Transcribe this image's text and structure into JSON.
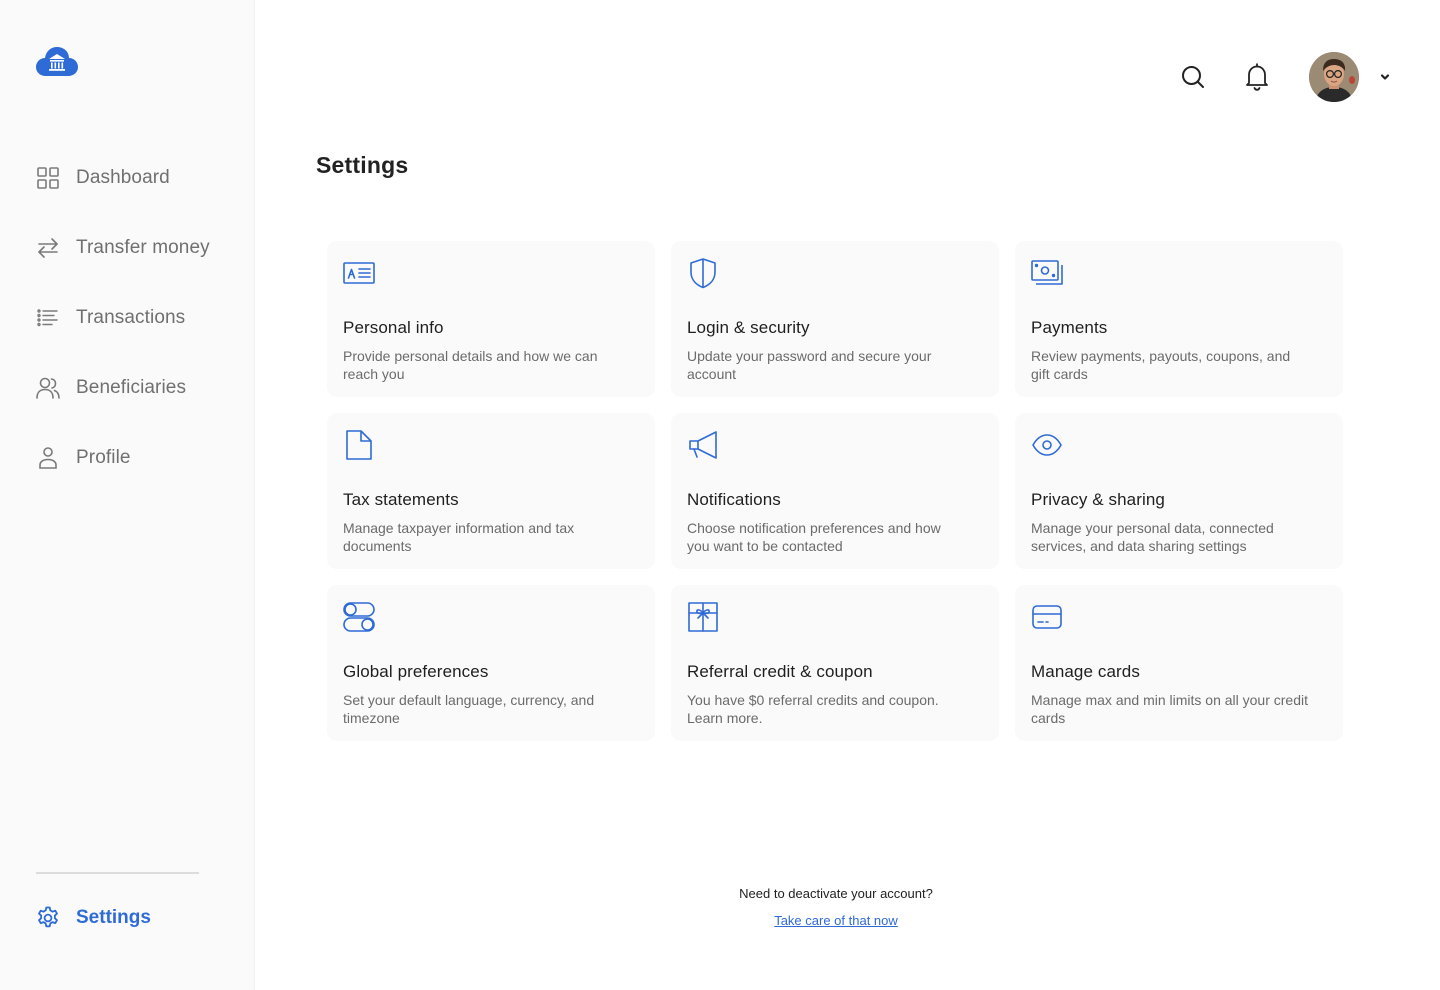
{
  "brand": {
    "logo_icon": "cloud-bank-icon",
    "accent_color": "#2f6bd6"
  },
  "sidebar": {
    "items": [
      {
        "label": "Dashboard",
        "icon": "grid-icon"
      },
      {
        "label": "Transfer money",
        "icon": "transfer-arrows-icon"
      },
      {
        "label": "Transactions",
        "icon": "list-icon"
      },
      {
        "label": "Beneficiaries",
        "icon": "users-icon"
      },
      {
        "label": "Profile",
        "icon": "person-icon"
      }
    ],
    "settings": {
      "label": "Settings",
      "icon": "gear-icon",
      "active": true
    }
  },
  "topbar": {
    "search_icon": "search-icon",
    "notifications_icon": "bell-icon",
    "avatar": "user-avatar",
    "menu_icon": "chevron-down-icon"
  },
  "main": {
    "title": "Settings",
    "cards": [
      {
        "title": "Personal info",
        "description": "Provide personal details and how we can reach you",
        "icon": "id-card-icon"
      },
      {
        "title": "Login & security",
        "description": "Update your password and secure your account",
        "icon": "shield-icon"
      },
      {
        "title": "Payments",
        "description": "Review payments, payouts, coupons, and gift cards",
        "icon": "banknote-icon"
      },
      {
        "title": "Tax statements",
        "description": "Manage taxpayer information and tax documents",
        "icon": "document-icon"
      },
      {
        "title": "Notifications",
        "description": "Choose notification preferences and how you want to be contacted",
        "icon": "megaphone-icon"
      },
      {
        "title": "Privacy & sharing",
        "description": "Manage your personal data, connected services, and data sharing settings",
        "icon": "eye-icon"
      },
      {
        "title": "Global preferences",
        "description": "Set your default language, currency, and timezone",
        "icon": "toggles-icon"
      },
      {
        "title": "Referral credit & coupon",
        "description": "You have $0 referral credits and coupon. Learn more.",
        "icon": "gift-icon"
      },
      {
        "title": "Manage cards",
        "description": "Manage max and min limits on all your credit cards",
        "icon": "credit-card-icon"
      }
    ]
  },
  "footer": {
    "question": "Need to deactivate your account?",
    "link": "Take care of that now"
  }
}
